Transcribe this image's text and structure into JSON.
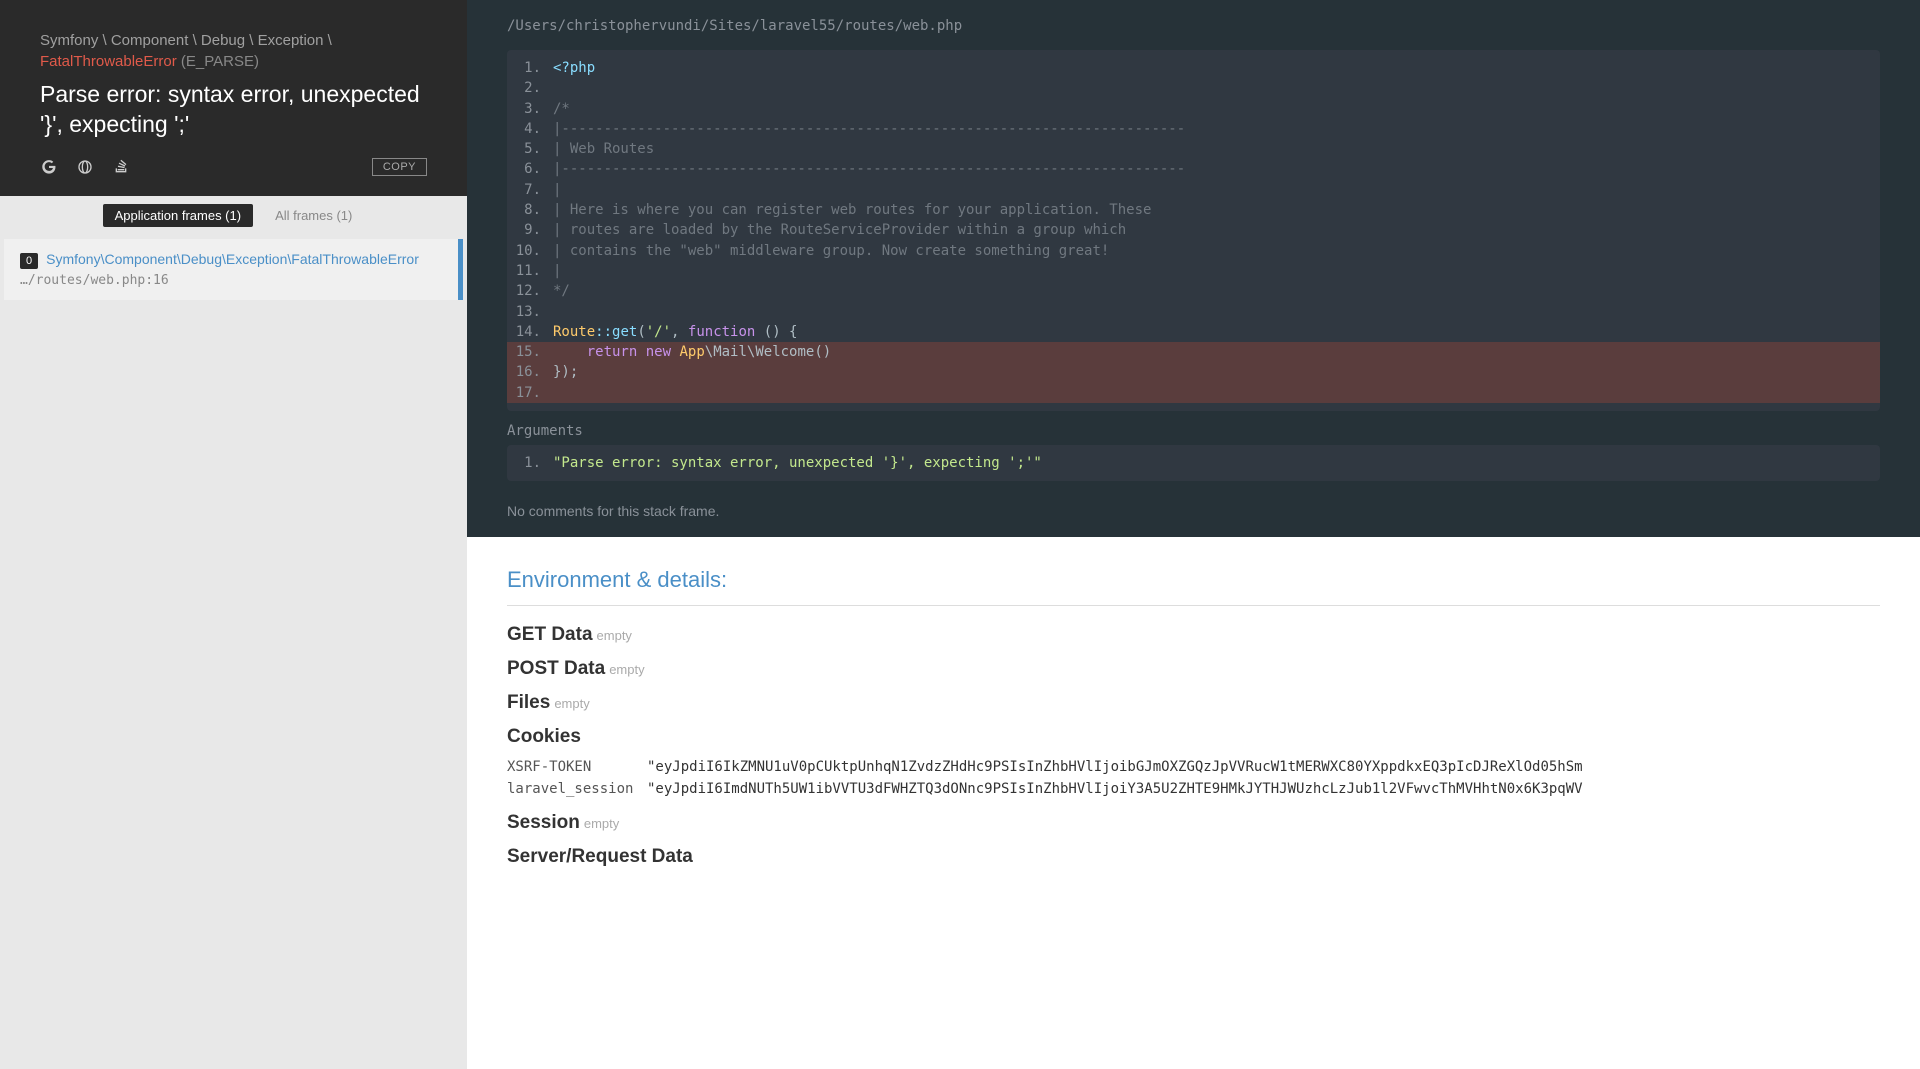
{
  "header": {
    "namespace_parts": [
      "Symfony",
      "Component",
      "Debug",
      "Exception"
    ],
    "error_class": "FatalThrowableError",
    "error_code": "(E_PARSE)",
    "title": "Parse error: syntax error, unexpected '}', expecting ';'",
    "copy_label": "COPY"
  },
  "tabs": {
    "app_frames": "Application frames (1)",
    "all_frames": "All frames (1)"
  },
  "frames": [
    {
      "index": "0",
      "title": "Symfony\\Component\\Debug\\Exception\\FatalThrowableError",
      "path": "…/routes/web.php:16"
    }
  ],
  "code": {
    "file_path": "/Users/christophervundi/Sites/laravel55/routes/web.php",
    "lines": [
      {
        "n": "1",
        "html": "<span class='tk-op'>&lt;?php</span>"
      },
      {
        "n": "2",
        "html": " "
      },
      {
        "n": "3",
        "html": "<span class='tk-comment'>/*</span>"
      },
      {
        "n": "4",
        "html": "<span class='tk-comment'>|--------------------------------------------------------------------------</span>"
      },
      {
        "n": "5",
        "html": "<span class='tk-comment'>| Web Routes</span>"
      },
      {
        "n": "6",
        "html": "<span class='tk-comment'>|--------------------------------------------------------------------------</span>"
      },
      {
        "n": "7",
        "html": "<span class='tk-comment'>|</span>"
      },
      {
        "n": "8",
        "html": "<span class='tk-comment'>| Here is where you can register web routes for your application. These</span>"
      },
      {
        "n": "9",
        "html": "<span class='tk-comment'>| routes are loaded by the RouteServiceProvider within a group which</span>"
      },
      {
        "n": "10",
        "html": "<span class='tk-comment'>| contains the \"web\" middleware group. Now create something great!</span>"
      },
      {
        "n": "11",
        "html": "<span class='tk-comment'>|</span>"
      },
      {
        "n": "12",
        "html": "<span class='tk-comment'>*/</span>"
      },
      {
        "n": "13",
        "html": " "
      },
      {
        "n": "14",
        "html": "<span class='tk-type'>Route</span><span class='tk-op'>::</span><span class='tk-func'>get</span>(<span class='tk-string'>'/'</span>, <span class='tk-keyword'>function</span> () {"
      },
      {
        "n": "15",
        "html": "    <span class='tk-keyword'>return</span> <span class='tk-keyword'>new</span> <span class='tk-type'>App</span>\\Mail\\Welcome()",
        "hi": true
      },
      {
        "n": "16",
        "html": "});",
        "hi": true
      },
      {
        "n": "17",
        "html": " ",
        "hi": true
      }
    ],
    "args_label": "Arguments",
    "arguments": [
      {
        "n": "1",
        "text": "\"Parse error: syntax error, unexpected '}', expecting ';'\""
      }
    ],
    "no_comments": "No comments for this stack frame."
  },
  "details": {
    "heading": "Environment & details:",
    "groups": [
      {
        "title": "GET Data",
        "empty": "empty"
      },
      {
        "title": "POST Data",
        "empty": "empty"
      },
      {
        "title": "Files",
        "empty": "empty"
      },
      {
        "title": "Cookies",
        "rows": [
          {
            "k": "XSRF-TOKEN",
            "v": "\"eyJpdiI6IkZMNU1uV0pCUktpUnhqN1ZvdzZHdHc9PSIsInZhbHVlIjoibGJmOXZGQzJpVVRucW1tMERWXC80YXppdkxEQ3pIcDJReXlOd05hSm"
          },
          {
            "k": "laravel_session",
            "v": "\"eyJpdiI6ImdNUTh5UW1ibVVTU3dFWHZTQ3dONnc9PSIsInZhbHVlIjoiY3A5U2ZHTE9HMkJYTHJWUzhcLzJub1l2VFwvcThMVHhtN0x6K3pqWV"
          }
        ]
      },
      {
        "title": "Session",
        "empty": "empty"
      },
      {
        "title": "Server/Request Data"
      }
    ]
  }
}
